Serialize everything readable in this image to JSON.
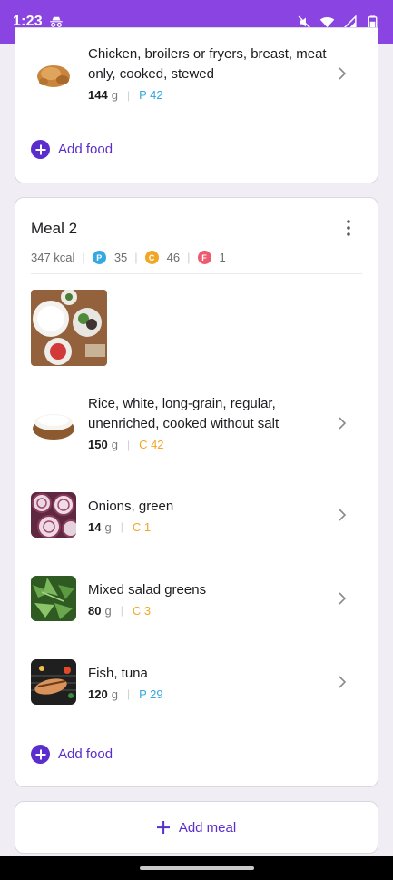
{
  "status_bar": {
    "time": "1:23",
    "left_icon": "incognito-icon",
    "right_icons": [
      "mute-icon",
      "wifi-icon",
      "signal-icon",
      "battery-icon"
    ],
    "background_color": "#8a44e2"
  },
  "meal1_card": {
    "items": [
      {
        "name": "Chicken, broilers or fryers, breast, meat only, cooked, stewed",
        "quantity": "144",
        "unit": "g",
        "macro": "P 42",
        "macro_type": "protein"
      }
    ],
    "add_food_label": "Add food"
  },
  "meal2_card": {
    "title": "Meal 2",
    "kcal": "347 kcal",
    "protein_badge": "P",
    "protein": "35",
    "carbs_badge": "C",
    "carbs": "46",
    "fat_badge": "F",
    "fat": "1",
    "items": [
      {
        "name": "Rice, white, long-grain, regular, unenriched, cooked without salt",
        "quantity": "150",
        "unit": "g",
        "macro": "C 42",
        "macro_type": "carbs"
      },
      {
        "name": "Onions, green",
        "quantity": "14",
        "unit": "g",
        "macro": "C 1",
        "macro_type": "carbs"
      },
      {
        "name": "Mixed salad greens",
        "quantity": "80",
        "unit": "g",
        "macro": "C 3",
        "macro_type": "carbs"
      },
      {
        "name": "Fish, tuna",
        "quantity": "120",
        "unit": "g",
        "macro": "P 29",
        "macro_type": "protein"
      }
    ],
    "add_food_label": "Add food"
  },
  "add_meal_label": "Add meal",
  "colors": {
    "accent": "#5a2dcc",
    "protein": "#34a8e0",
    "carbs": "#f1a626",
    "fat": "#ee5a6e"
  }
}
